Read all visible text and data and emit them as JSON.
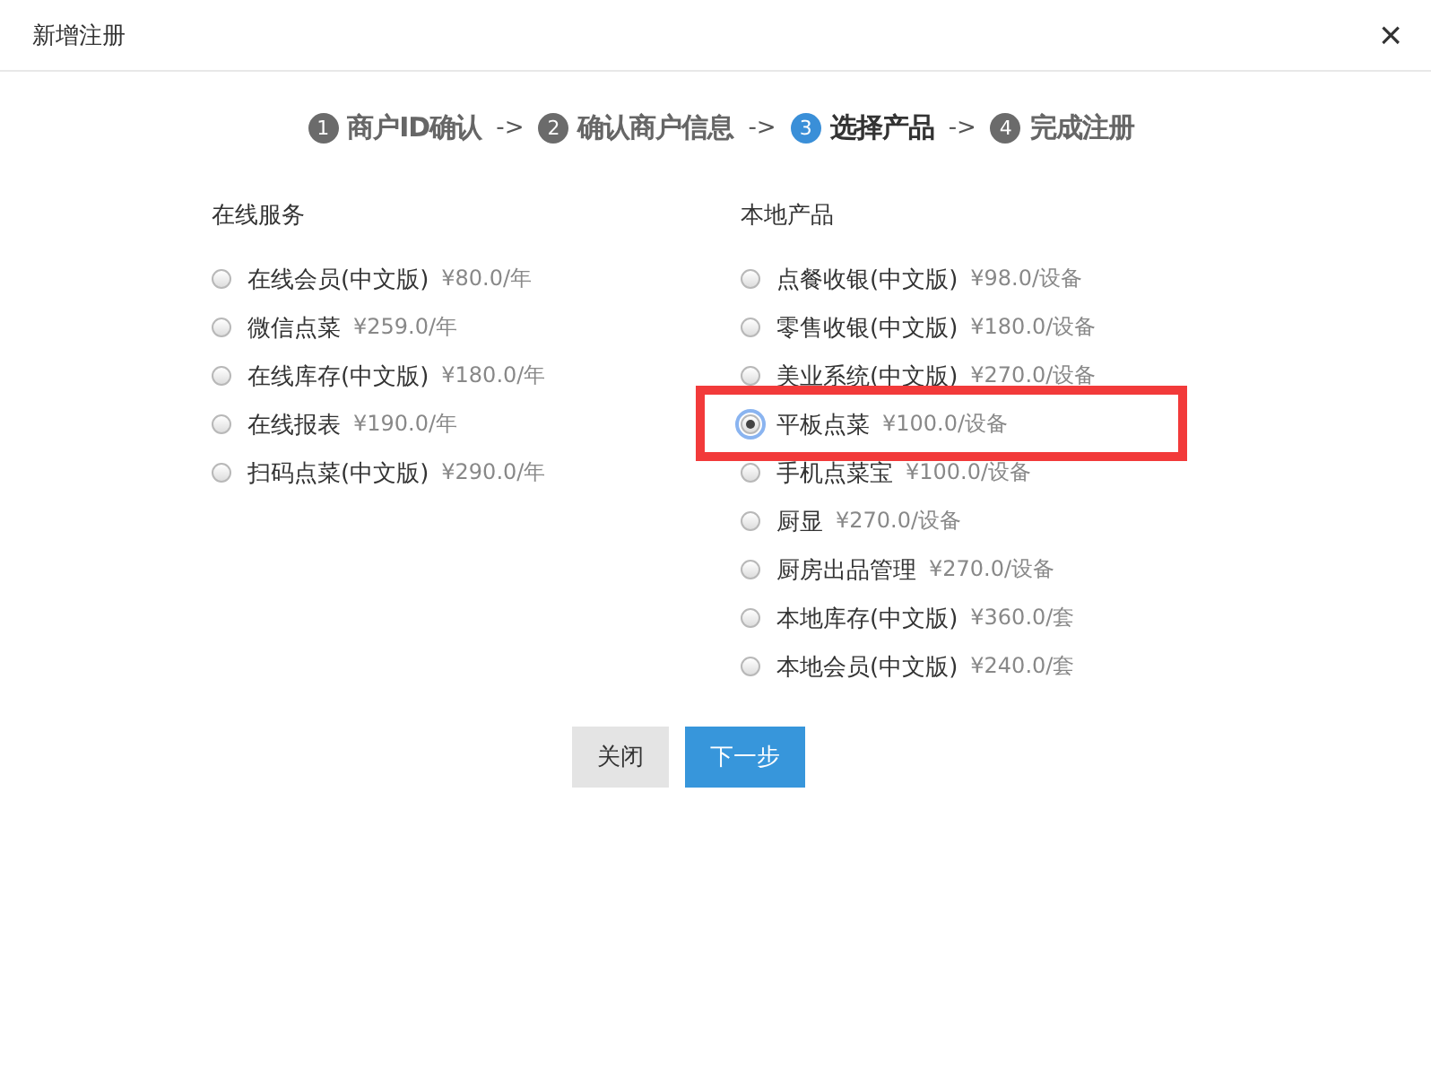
{
  "dialog": {
    "title": "新增注册",
    "close": "×"
  },
  "steps": [
    {
      "number": "1",
      "label": "商户ID确认",
      "selected": false,
      "separator": "->"
    },
    {
      "number": "2",
      "label": "确认商户信息",
      "selected": false,
      "separator": "->"
    },
    {
      "number": "3",
      "label": "选择产品",
      "selected": true,
      "separator": "->"
    },
    {
      "number": "4",
      "label": "完成注册",
      "selected": false
    }
  ],
  "groups": [
    {
      "title": "在线服务",
      "items": [
        {
          "name": "在线会员(中文版)",
          "price": "¥80.0/年",
          "selected": false,
          "highlighted": false
        },
        {
          "name": "微信点菜",
          "price": "¥259.0/年",
          "selected": false,
          "highlighted": false
        },
        {
          "name": "在线库存(中文版)",
          "price": "¥180.0/年",
          "selected": false,
          "highlighted": false
        },
        {
          "name": "在线报表",
          "price": "¥190.0/年",
          "selected": false,
          "highlighted": false
        },
        {
          "name": "扫码点菜(中文版)",
          "price": "¥290.0/年",
          "selected": false,
          "highlighted": false
        }
      ]
    },
    {
      "title": "本地产品",
      "items": [
        {
          "name": "点餐收银(中文版)",
          "price": "¥98.0/设备",
          "selected": false,
          "highlighted": false
        },
        {
          "name": "零售收银(中文版)",
          "price": "¥180.0/设备",
          "selected": false,
          "highlighted": false
        },
        {
          "name": "美业系统(中文版)",
          "price": "¥270.0/设备",
          "selected": false,
          "highlighted": false
        },
        {
          "name": "平板点菜",
          "price": "¥100.0/设备",
          "selected": true,
          "highlighted": true
        },
        {
          "name": "手机点菜宝",
          "price": "¥100.0/设备",
          "selected": false,
          "highlighted": false
        },
        {
          "name": "厨显",
          "price": "¥270.0/设备",
          "selected": false,
          "highlighted": false
        },
        {
          "name": "厨房出品管理",
          "price": "¥270.0/设备",
          "selected": false,
          "highlighted": false
        },
        {
          "name": "本地库存(中文版)",
          "price": "¥360.0/套",
          "selected": false,
          "highlighted": false
        },
        {
          "name": "本地会员(中文版)",
          "price": "¥240.0/套",
          "selected": false,
          "highlighted": false
        }
      ]
    }
  ],
  "buttons": [
    {
      "label": "关闭",
      "kind": "secondary"
    },
    {
      "label": "下一步",
      "kind": "primary"
    }
  ]
}
